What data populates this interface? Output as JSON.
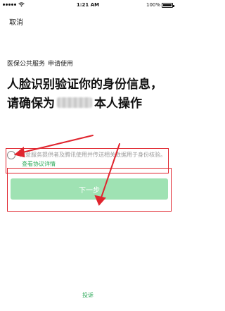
{
  "status_bar": {
    "time": "1:21 AM",
    "battery": "100%",
    "battery_level": 1.0
  },
  "nav": {
    "cancel_label": "取消"
  },
  "service": {
    "name": "医保公共服务",
    "action": "申请使用"
  },
  "heading": {
    "line_before_name": "人脸识别验证你的身份信息，请确保为",
    "line_after_name": "本人操作"
  },
  "consent": {
    "checked": false,
    "text": "同意服务提供者及腾讯使用并传送相关数据用于身份核验。",
    "link_label": "查看协议详情"
  },
  "next_button": {
    "label": "下一步"
  },
  "footer": {
    "complaint_label": "投诉"
  },
  "colors": {
    "accent_green": "#2faa5b",
    "button_disabled": "#9fe2b3",
    "annotation_red": "#e0252e"
  }
}
